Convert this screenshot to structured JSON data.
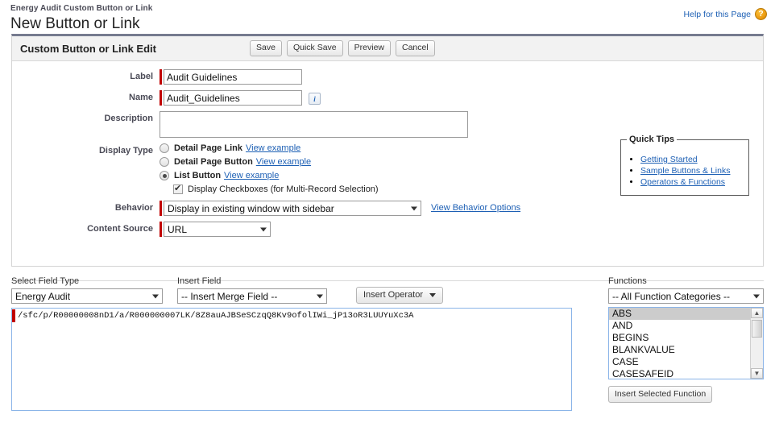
{
  "header": {
    "breadcrumb": "Energy Audit Custom Button or Link",
    "title": "New Button or Link",
    "help_label": "Help for this Page",
    "help_icon": "question-mark-icon"
  },
  "panel": {
    "title": "Custom Button or Link Edit",
    "buttons": [
      {
        "label": "Save"
      },
      {
        "label": "Quick Save"
      },
      {
        "label": "Preview"
      },
      {
        "label": "Cancel"
      }
    ]
  },
  "form": {
    "label_row": {
      "label": "Label",
      "value": "Audit Guidelines"
    },
    "name_row": {
      "label": "Name",
      "value": "Audit_Guidelines",
      "info_icon": "info-icon"
    },
    "description_row": {
      "label": "Description",
      "value": "",
      "placeholder": ""
    },
    "display_type": {
      "label": "Display Type",
      "options": [
        {
          "label": "Detail Page Link",
          "example": "View example",
          "selected": false
        },
        {
          "label": "Detail Page Button",
          "example": "View example",
          "selected": false
        },
        {
          "label": "List Button",
          "example": "View example",
          "selected": true
        }
      ],
      "checkbox": {
        "label": "Display Checkboxes (for Multi-Record Selection)",
        "checked": true
      }
    },
    "behavior": {
      "label": "Behavior",
      "value": "Display in existing window with sidebar",
      "link": "View Behavior Options"
    },
    "content_source": {
      "label": "Content Source",
      "value": "URL"
    }
  },
  "quick_tips": {
    "legend": "Quick Tips",
    "links": [
      "Getting Started",
      "Sample Buttons & Links",
      "Operators & Functions"
    ]
  },
  "formula_editor": {
    "field_type_label": "Select Field Type",
    "field_type_value": "Energy Audit",
    "insert_field_label": "Insert Field",
    "insert_field_value": "-- Insert Merge Field --",
    "insert_operator_label": "Insert Operator",
    "formula_value": "/sfc/p/R00000008nD1/a/R000000007LK/8Z8auAJBSeSCzqQ8Kv9ofolIWi_jP13oR3LUUYuXc3A",
    "functions_label": "Functions",
    "functions_category": "-- All Function Categories --",
    "functions": [
      {
        "name": "ABS",
        "selected": true
      },
      {
        "name": "AND",
        "selected": false
      },
      {
        "name": "BEGINS",
        "selected": false
      },
      {
        "name": "BLANKVALUE",
        "selected": false
      },
      {
        "name": "CASE",
        "selected": false
      },
      {
        "name": "CASESAFEID",
        "selected": false
      }
    ],
    "insert_function_label": "Insert Selected Function"
  },
  "colors": {
    "required_bar": "#c00000",
    "link": "#1c5fb4",
    "panel_top_border": "#767b8f",
    "focus_border": "#8ab4e8"
  }
}
